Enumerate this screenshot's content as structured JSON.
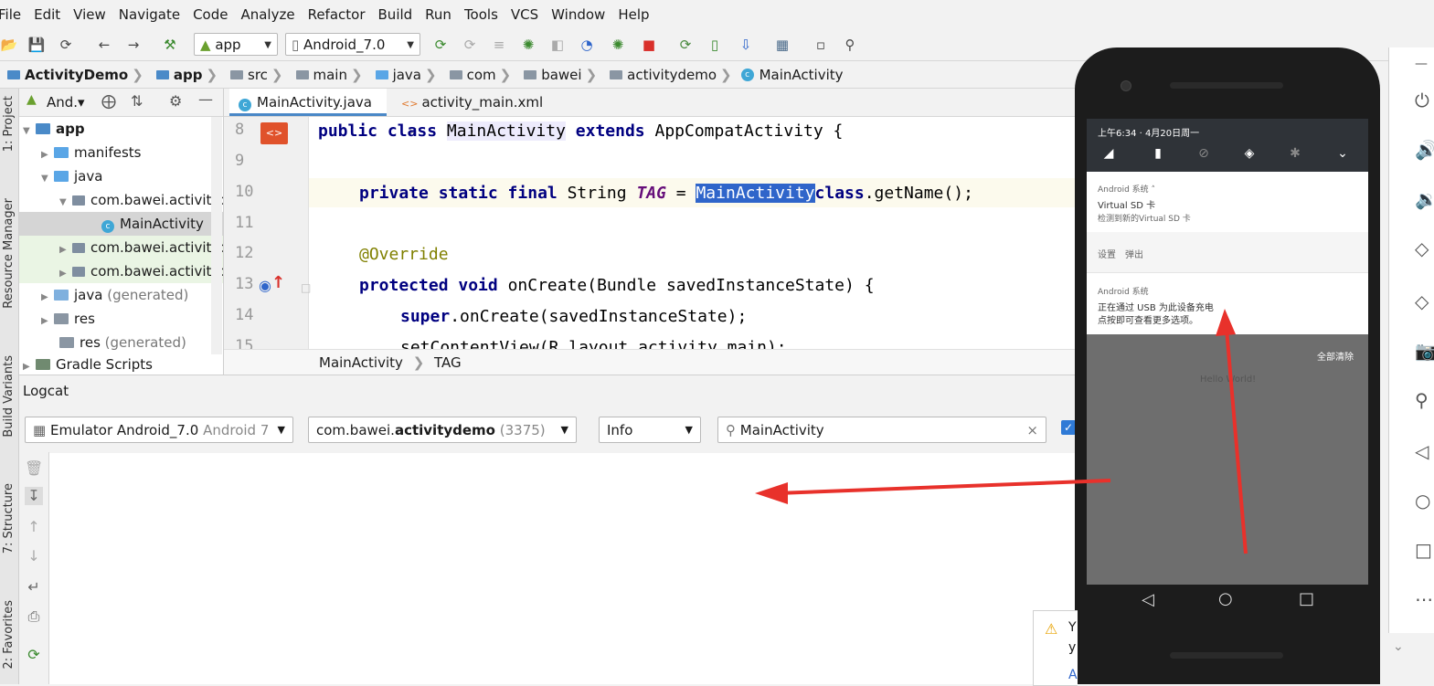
{
  "menu": [
    "File",
    "Edit",
    "View",
    "Navigate",
    "Code",
    "Analyze",
    "Refactor",
    "Build",
    "Run",
    "Tools",
    "VCS",
    "Window",
    "Help"
  ],
  "toolbar": {
    "run_config": "app",
    "device": "Android_7.0"
  },
  "breadcrumb": [
    "ActivityDemo",
    "app",
    "src",
    "main",
    "java",
    "com",
    "bawei",
    "activitydemo",
    "MainActivity"
  ],
  "stripe_tabs": [
    "1: Project",
    "Resource Manager",
    "Build Variants",
    "7: Structure",
    "2: Favorites"
  ],
  "project": {
    "view_label": "And.▾",
    "tree": [
      {
        "label": "app",
        "bold": true
      },
      {
        "label": "manifests"
      },
      {
        "label": "java"
      },
      {
        "label": "com.bawei.activityd"
      },
      {
        "label": "MainActivity"
      },
      {
        "label": "com.bawei.activityd"
      },
      {
        "label": "com.bawei.activityd"
      },
      {
        "label": "java",
        "suffix": "(generated)"
      },
      {
        "label": "res"
      },
      {
        "label": "res",
        "suffix": "(generated)"
      },
      {
        "label": "Gradle Scripts"
      }
    ]
  },
  "editor": {
    "tabs": [
      "MainActivity.java",
      "activity_main.xml"
    ],
    "line_numbers": [
      "8",
      "9",
      "10",
      "11",
      "12",
      "13",
      "14",
      "15"
    ],
    "code": {
      "l8a": "public class ",
      "l8b": "MainActivity",
      "l8c": " extends ",
      "l8d": "AppCompatActivity {",
      "l10a": "private static final ",
      "l10b": "String ",
      "l10c": "TAG",
      "l10d": " = ",
      "l10e": "MainActivity",
      ".": ".",
      "l10f": "class",
      "l10g": ".getName();",
      "l12": "@Override",
      "l13a": "protected void ",
      "l13b": "onCreate(Bundle savedInstanceState) {",
      "l14a": "super",
      "l14b": ".onCreate(savedInstanceState);",
      "l15": "setContentView(R.layout.activity_main);"
    },
    "breadcrumb": [
      "MainActivity",
      "TAG"
    ]
  },
  "logcat": {
    "title": "Logcat",
    "device": "Emulator Android_7.0",
    "device_suffix": "Android 7",
    "process_pre": "com.bawei.",
    "process_bold": "activitydemo",
    "process_pid": "(3375)",
    "level": "Info",
    "search": "MainActivity"
  },
  "phone": {
    "time": "上午6:34 · 4月20日周一",
    "notif1_app": "Android 系统 ˄",
    "notif1_title": "Virtual SD 卡",
    "notif1_text": "检测到新的Virtual SD 卡",
    "notif1_action1": "设置",
    "notif1_action2": "弹出",
    "notif2_app": "Android 系统",
    "notif2_title": "正在通过 USB 为此设备充电",
    "notif2_text": "点按即可查看更多选项。",
    "clear_all": "全部清除",
    "app_text": "Hello World!"
  },
  "notification_box": {
    "text1": "Y",
    "text2": "y",
    "link": "A"
  },
  "colors": {
    "accent_arrow": "#e8312b",
    "selection": "#2f65ca",
    "phone_body": "#1c1c1c"
  }
}
